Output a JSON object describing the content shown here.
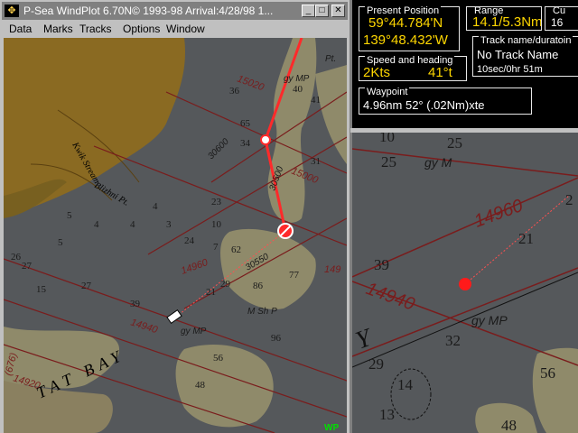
{
  "window": {
    "title": "P-Sea WindPlot 6.70N© 1993-98 Arrival:4/28/98 1...",
    "app_icon": "compass-icon",
    "min_label": "_",
    "max_label": "□",
    "close_label": "✕"
  },
  "menu": [
    "Data",
    "Marks",
    "Tracks",
    "Options",
    "Window"
  ],
  "chart_labels": {
    "soundings_left": [
      "27",
      "36",
      "39",
      "15",
      "27",
      "21",
      "24",
      "29",
      "26",
      "23",
      "4",
      "4",
      "3",
      "5",
      "7",
      "10",
      "65",
      "40",
      "41",
      "34",
      "31",
      "62",
      "77",
      "86",
      "96",
      "56",
      "48",
      "4",
      "5"
    ],
    "n14960": "14960",
    "n15000": "15000",
    "n15020": "15020",
    "n14940": "14940",
    "n14920": "14920",
    "n30600": "30600",
    "n30550": "30550",
    "n30500": "30500",
    "gy_mp": "gy MP",
    "gy_mp2": "gy MP",
    "kwik": "Kwik Stream",
    "blizhni": "Blizhni Pt.",
    "tat_bay": "TAT BAY",
    "ms": "M Sh P",
    "pt": "Pt.",
    "n676": "(676)",
    "n15_5": "15 5",
    "n20": "20",
    "n1498": "149",
    "wp": "WP"
  },
  "present_position": {
    "label": "Present Position",
    "lat": "59°44.784'N",
    "lon": "139°48.432'W"
  },
  "range": {
    "label": "Range",
    "value": "14.1/5.3Nm"
  },
  "cu": {
    "label": "Cu",
    "value": "16"
  },
  "track": {
    "label": "Track name/duratoin",
    "name": "No Track Name",
    "duration": "10sec/0hr 51m"
  },
  "speed": {
    "label": "Speed and heading",
    "speed": "2Kts",
    "heading": "41°t"
  },
  "waypoint": {
    "label": "Waypoint",
    "value": "4.96nm 52° (.02Nm)xte"
  },
  "zoom_labels": {
    "n10": "10",
    "n25a": "25",
    "n25b": "25",
    "gym": "gy M",
    "n14960": "14960",
    "n21": "21",
    "n2": "2",
    "n39": "39",
    "n14940": "14940",
    "gymp": "gy MP",
    "n32": "32",
    "n29": "29",
    "n14": "14",
    "n13": "13",
    "n56": "56",
    "n48": "48",
    "y": "Y"
  },
  "colors": {
    "water": "#55585b",
    "land": "#8a6a22",
    "shoal": "#8f8a6a",
    "grid": "#7a1c1c",
    "track": "#ff2a2a",
    "value_text": "#ffd700"
  }
}
